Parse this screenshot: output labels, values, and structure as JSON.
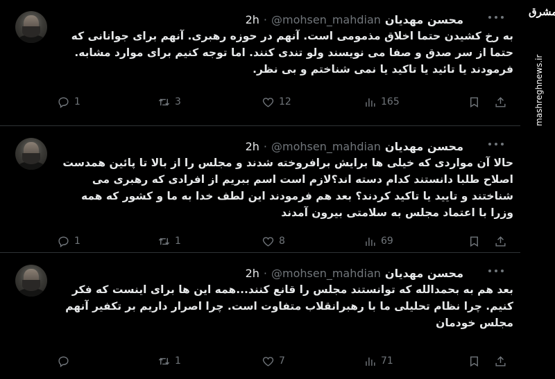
{
  "tweets": [
    {
      "author_name": "محسن مهدیان",
      "handle": "@mohsen_mahdian",
      "separator": "·",
      "time": "2h",
      "text": "به رخ کشیدن حتما اخلاق مذمومی است. آنهم در حوزه رهبری. آنهم برای جوانانی که حتما از سر صدق و صفا می نویسند ولو تندی کنند. اما توجه کنیم برای موارد مشابه. فرمودند یا تائید یا تاکید یا نمی شناختم و بی نظر.",
      "replies": "1",
      "retweets": "3",
      "likes": "12",
      "views": "165"
    },
    {
      "author_name": "محسن مهدیان",
      "handle": "@mohsen_mahdian",
      "separator": "·",
      "time": "2h",
      "text": "حالا آن مواردی که خیلی ها برایش برافروخته شدند و مجلس را از بالا تا پائین همدست اصلاح طلبا دانستند کدام دسته اند؟لازم است اسم ببریم از افرادی که رهبری می شناختند و تایید یا تاکید کردند؟ بعد هم فرمودند این لطف خدا به ما و کشور که همه وزرا با اعتماد مجلس به سلامتی بیرون آمدند",
      "replies": "1",
      "retweets": "1",
      "likes": "8",
      "views": "69"
    },
    {
      "author_name": "محسن مهدیان",
      "handle": "@mohsen_mahdian",
      "separator": "·",
      "time": "2h",
      "text": "بعد هم به بحمدالله که توانستند مجلس را قانع کنند...همه این ها برای اینست که فکر کنیم. چرا نظام تحلیلی ما با رهبرانقلاب متفاوت است. چرا اصرار داریم بر تکفیر آنهم مجلس خودمان",
      "replies": "",
      "retweets": "1",
      "likes": "7",
      "views": "71"
    }
  ],
  "watermark": {
    "logo": "مشرق",
    "site": "mashreghnews.ir"
  },
  "icons": {
    "reply": "reply-icon",
    "retweet": "retweet-icon",
    "like": "heart-icon",
    "views": "views-chart-icon",
    "bookmark": "bookmark-icon",
    "share": "share-icon",
    "more": "more-options-icon"
  },
  "colors": {
    "background": "#000000",
    "text": "#e7e9ea",
    "muted": "#71767b",
    "divider": "#2f3336"
  }
}
